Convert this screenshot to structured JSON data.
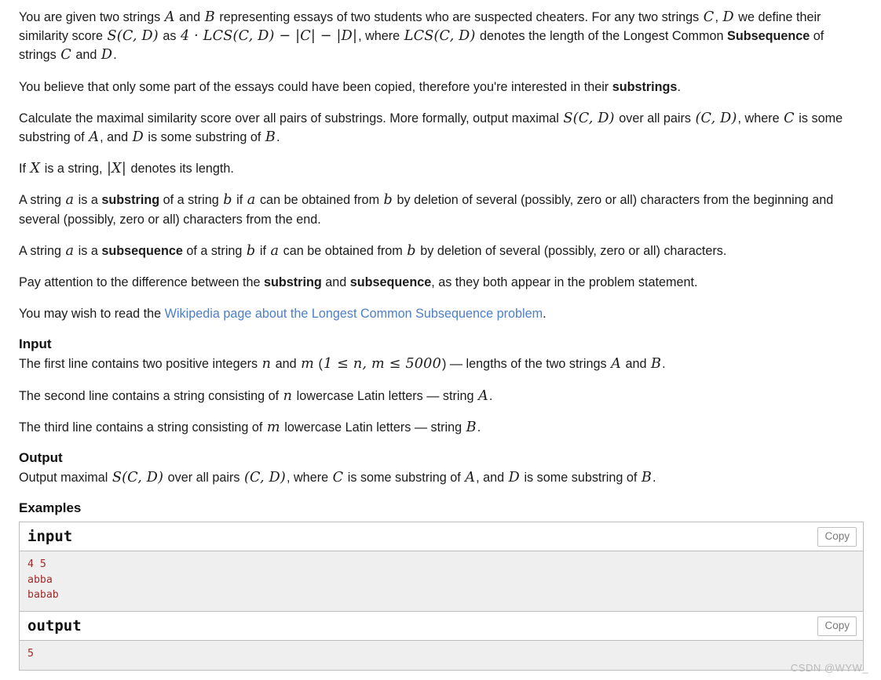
{
  "statement": {
    "p1": {
      "t1": "You are given two strings ",
      "m_A": "A",
      "t2": " and ",
      "m_B": "B",
      "t3": " representing essays of two students who are suspected cheaters. For any two strings ",
      "m_C": "C",
      "t4": ", ",
      "m_D": "D",
      "t5": " we define their similarity score ",
      "m_SCD": "S(C, D)",
      "t6": " as ",
      "m_formula": "4 · LCS(C, D) − |C| − |D|",
      "t7": ", where ",
      "m_LCS": "LCS(C, D)",
      "t8": " denotes the length of the Longest Common ",
      "bold_subsequence": "Subsequence",
      "t9": " of strings ",
      "m_C2": "C",
      "t10": " and ",
      "m_D2": "D",
      "t11": "."
    },
    "p2": {
      "t1": "You believe that only some part of the essays could have been copied, therefore you're interested in their ",
      "bold": "substrings",
      "t2": "."
    },
    "p3": {
      "t1": "Calculate the maximal similarity score over all pairs of substrings. More formally, output maximal ",
      "m_SCD": "S(C, D)",
      "t2": " over all pairs ",
      "m_pair": "(C, D)",
      "t3": ", where ",
      "m_C": "C",
      "t4": " is some substring of ",
      "m_A": "A",
      "t5": ", and ",
      "m_D": "D",
      "t6": " is some substring of ",
      "m_B": "B",
      "t7": "."
    },
    "p4": {
      "t1": "If ",
      "m_X": "X",
      "t2": " is a string, ",
      "m_absX": "|X|",
      "t3": " denotes its length."
    },
    "p5": {
      "t1": "A string ",
      "m_a": "a",
      "t2": " is a ",
      "bold": "substring",
      "t3": " of a string ",
      "m_b": "b",
      "t4": " if ",
      "m_a2": "a",
      "t5": " can be obtained from ",
      "m_b2": "b",
      "t6": " by deletion of several (possibly, zero or all) characters from the beginning and several (possibly, zero or all) characters from the end."
    },
    "p6": {
      "t1": "A string ",
      "m_a": "a",
      "t2": " is a ",
      "bold": "subsequence",
      "t3": " of a string ",
      "m_b": "b",
      "t4": " if ",
      "m_a2": "a",
      "t5": " can be obtained from ",
      "m_b2": "b",
      "t6": " by deletion of several (possibly, zero or all) characters."
    },
    "p7": {
      "t1": "Pay attention to the difference between the ",
      "bold1": "substring",
      "t2": " and ",
      "bold2": "subsequence",
      "t3": ", as they both appear in the problem statement."
    },
    "p8": {
      "t1": "You may wish to read the ",
      "link": "Wikipedia page about the Longest Common Subsequence problem",
      "t2": "."
    }
  },
  "input_section": {
    "title": "Input",
    "line1": {
      "t1": "The first line contains two positive integers ",
      "m_n": "n",
      "t2": " and ",
      "m_m": "m",
      "t3": " (",
      "m_constraint": "1 ≤ n, m ≤ 5000",
      "t4": ") — lengths of the two strings ",
      "m_A": "A",
      "t5": " and ",
      "m_B": "B",
      "t6": "."
    },
    "line2": {
      "t1": "The second line contains a string consisting of ",
      "m_n": "n",
      "t2": " lowercase Latin letters — string ",
      "m_A": "A",
      "t3": "."
    },
    "line3": {
      "t1": "The third line contains a string consisting of ",
      "m_m": "m",
      "t2": " lowercase Latin letters — string ",
      "m_B": "B",
      "t3": "."
    }
  },
  "output_section": {
    "title": "Output",
    "line1": {
      "t1": "Output maximal ",
      "m_SCD": "S(C, D)",
      "t2": " over all pairs ",
      "m_pair": "(C, D)",
      "t3": ", where ",
      "m_C": "C",
      "t4": " is some substring of ",
      "m_A": "A",
      "t5": ", and ",
      "m_D": "D",
      "t6": " is some substring of ",
      "m_B": "B",
      "t7": "."
    }
  },
  "examples": {
    "title": "Examples",
    "copy_label": "Copy",
    "input": {
      "label": "input",
      "content": "4 5\nabba\nbabab"
    },
    "output": {
      "label": "output",
      "content": "5"
    }
  },
  "watermark": "CSDN @WYW_",
  "colors": {
    "link": "#4c7fc8",
    "code": "#9b2d2d",
    "code_bg": "#efefef",
    "border": "#bdbdbd",
    "copy_text": "#7a7a7a",
    "watermark": "#b9b9b9"
  }
}
